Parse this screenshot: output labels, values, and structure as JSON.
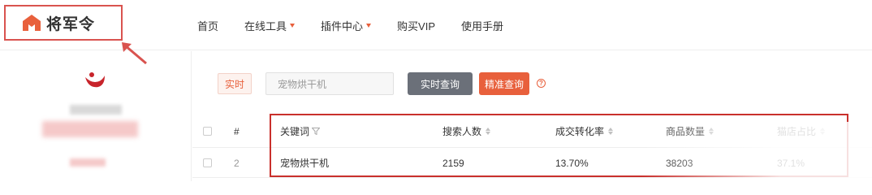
{
  "brand": {
    "name": "将军令",
    "accent": "#e8603c",
    "annotation_color": "#d9534f"
  },
  "nav": {
    "items": [
      {
        "label": "首页",
        "dropdown": false
      },
      {
        "label": "在线工具",
        "dropdown": true
      },
      {
        "label": "插件中心",
        "dropdown": true
      },
      {
        "label": "购买VIP",
        "dropdown": false
      },
      {
        "label": "使用手册",
        "dropdown": false
      }
    ]
  },
  "search": {
    "mode_tag": "实时",
    "value": "宠物烘干机",
    "realtime_button": "实时查询",
    "precise_button": "精准查询",
    "help_icon": "question-circle-icon",
    "help_glyph": "?"
  },
  "table": {
    "columns": [
      "#",
      "关键词",
      "搜索人数",
      "成交转化率",
      "商品数量",
      "猫店占比"
    ],
    "rows": [
      {
        "index": "2",
        "keyword": "宠物烘干机",
        "searchers": "2159",
        "conversion": "13.70%",
        "products": "38203",
        "tmall_share": "37.1%"
      }
    ]
  }
}
